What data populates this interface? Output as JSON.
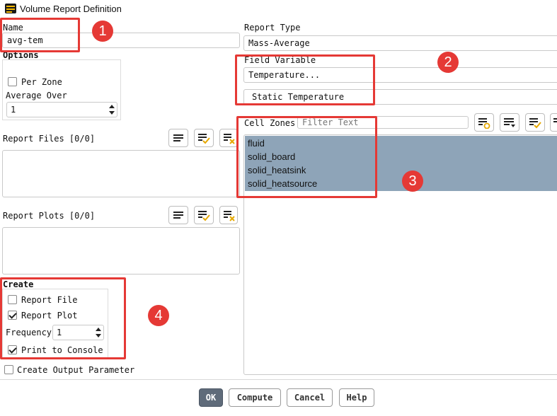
{
  "window": {
    "title": "Volume Report Definition"
  },
  "name": {
    "label": "Name",
    "value": "avg-tem"
  },
  "options": {
    "title": "Options",
    "per_zone": {
      "label": "Per Zone",
      "checked": false
    },
    "average_over": {
      "label": "Average Over",
      "value": "1"
    }
  },
  "report_files": {
    "label": "Report Files [0/0]"
  },
  "report_plots": {
    "label": "Report Plots [0/0]"
  },
  "create": {
    "title": "Create",
    "report_file": {
      "label": "Report File",
      "checked": false
    },
    "report_plot": {
      "label": "Report Plot",
      "checked": true
    },
    "frequency": {
      "label": "Frequency",
      "value": "1"
    },
    "print_to_console": {
      "label": "Print to Console",
      "checked": true
    }
  },
  "create_output_parameter": {
    "label": "Create Output Parameter",
    "checked": false
  },
  "report_type": {
    "label": "Report Type",
    "value": "Mass-Average"
  },
  "field_variable": {
    "label": "Field Variable",
    "category": "Temperature...",
    "variable": "Static Temperature"
  },
  "cell_zones": {
    "label": "Cell Zones",
    "filter_placeholder": "Filter Text",
    "items": [
      "fluid",
      "solid_board",
      "solid_heatsink",
      "solid_heatsource"
    ],
    "selected_color": "#8ea4b8"
  },
  "annotations": [
    "1",
    "2",
    "3",
    "4"
  ],
  "buttons": {
    "ok": "OK",
    "compute": "Compute",
    "cancel": "Cancel",
    "help": "Help"
  },
  "colors": {
    "highlight_red": "#e53935",
    "ok_button": "#5f6b7a"
  },
  "icons": [
    "list-icon",
    "select-all-icon",
    "deselect-all-icon",
    "filter-list-icon",
    "sort-icon"
  ]
}
